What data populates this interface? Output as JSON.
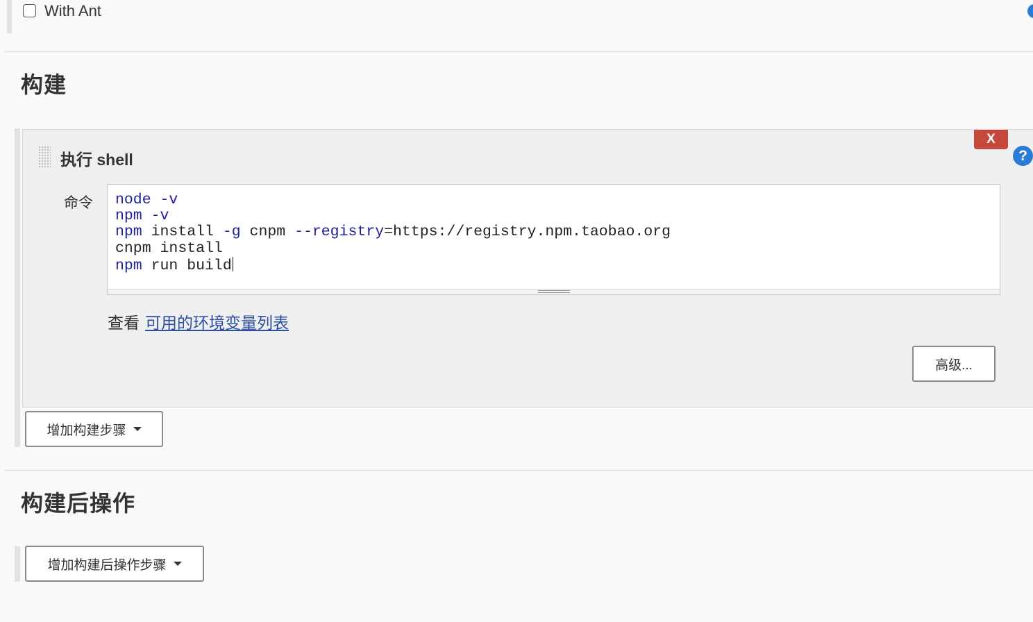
{
  "top_option": {
    "checkbox_label": "With Ant",
    "checked": false
  },
  "build_section": {
    "title": "构建",
    "step": {
      "title": "执行 shell",
      "delete_label": "X",
      "help_label": "?",
      "command_label": "命令",
      "command_lines": [
        [
          {
            "text": "node",
            "kind": "cmd"
          },
          {
            "text": " ",
            "kind": "text"
          },
          {
            "text": "-v",
            "kind": "flag"
          }
        ],
        [
          {
            "text": "npm",
            "kind": "cmd"
          },
          {
            "text": " ",
            "kind": "text"
          },
          {
            "text": "-v",
            "kind": "flag"
          }
        ],
        [
          {
            "text": "npm",
            "kind": "cmd"
          },
          {
            "text": " install ",
            "kind": "text"
          },
          {
            "text": "-g",
            "kind": "flag"
          },
          {
            "text": " cnpm ",
            "kind": "text"
          },
          {
            "text": "--registry",
            "kind": "flag"
          },
          {
            "text": "=https://registry.npm.taobao.org",
            "kind": "text"
          }
        ],
        [
          {
            "text": "cnpm install",
            "kind": "text"
          }
        ],
        [
          {
            "text": "npm",
            "kind": "cmd"
          },
          {
            "text": " run build",
            "kind": "text"
          }
        ]
      ],
      "env_prefix": "查看",
      "env_link": "可用的环境变量列表",
      "advanced_button": "高级..."
    },
    "add_step_button": "增加构建步骤"
  },
  "post_build_section": {
    "title": "构建后操作",
    "add_step_button": "增加构建后操作步骤"
  },
  "colors": {
    "background": "#f9f9f9",
    "panel": "#efefef",
    "delete_button": "#c4483c",
    "help_icon": "#2b7bd6",
    "link": "#2c4ea3",
    "code_keyword": "#20209a"
  }
}
